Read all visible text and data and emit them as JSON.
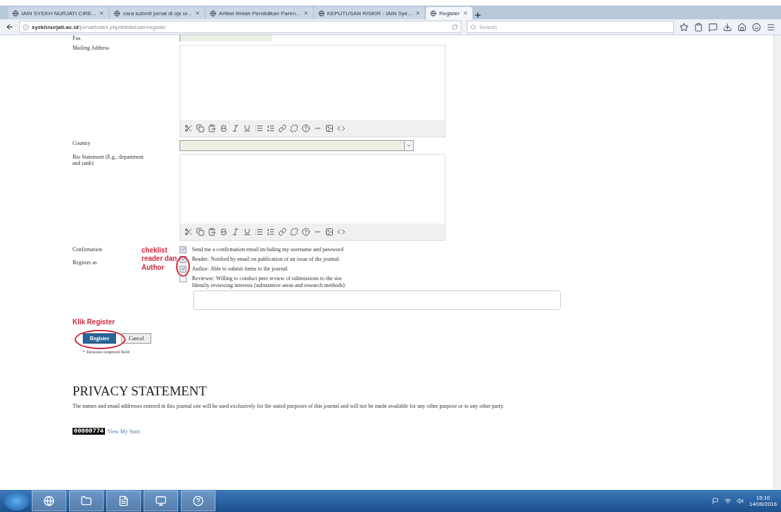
{
  "browser": {
    "tabs": [
      {
        "title": "IAIN SYEKH NURJATI CIRE...",
        "selected": false
      },
      {
        "title": "cara submit jurnal di ojs ur...",
        "selected": false
      },
      {
        "title": "Artikel Ilmiah Pendidikan Paren...",
        "selected": false
      },
      {
        "title": "KEPUTUSAN RISKIR - IAIN Sye...",
        "selected": false
      },
      {
        "title": "Register",
        "selected": true
      }
    ],
    "url_host": "syekhnurjati.ac.id",
    "url_path": "/jurnal/index.php/ibtida/user/register",
    "search_placeholder": "Search"
  },
  "form": {
    "fax_label": "Fax",
    "mailing_label": "Mailing Address",
    "country_label": "Country",
    "bio_label": "Bio Statement (E.g., department and rank)",
    "confirmation": {
      "label": "Confirmation",
      "checked": true,
      "text": "Send me a confirmation email including my username and password"
    },
    "register_label": "Register as",
    "roles": [
      {
        "kind": "plain",
        "checked": true,
        "text": "Reader: Notified by email on publication of an issue of the journal."
      },
      {
        "kind": "plain",
        "checked": true,
        "text": "Author: Able to submit items to the journal."
      },
      {
        "kind": "interests",
        "checked": false,
        "text": "Reviewer: Willing to conduct peer review of submissions to the site.",
        "hint": "Identify reviewing interests (substantive areas and research methods):"
      }
    ],
    "buttons": [
      {
        "label": "Register",
        "kind": "primary"
      },
      {
        "label": "Cancel",
        "kind": "secondary"
      }
    ],
    "note": "* Denotes required field"
  },
  "annotations": {
    "checklist": "cheklist reader dan Author",
    "register": "Klik Register"
  },
  "privacy": {
    "heading": "PRIVACY STATEMENT",
    "text": "The names and email addresses entered in this journal site will be used exclusively for the stated purposes of this journal and will not be made available for any other purpose or to any other party."
  },
  "footer": {
    "counter": "00000774",
    "stats_link": "View My Stats"
  },
  "taskbar": {
    "time": "15:10",
    "date": "14/06/2016"
  }
}
